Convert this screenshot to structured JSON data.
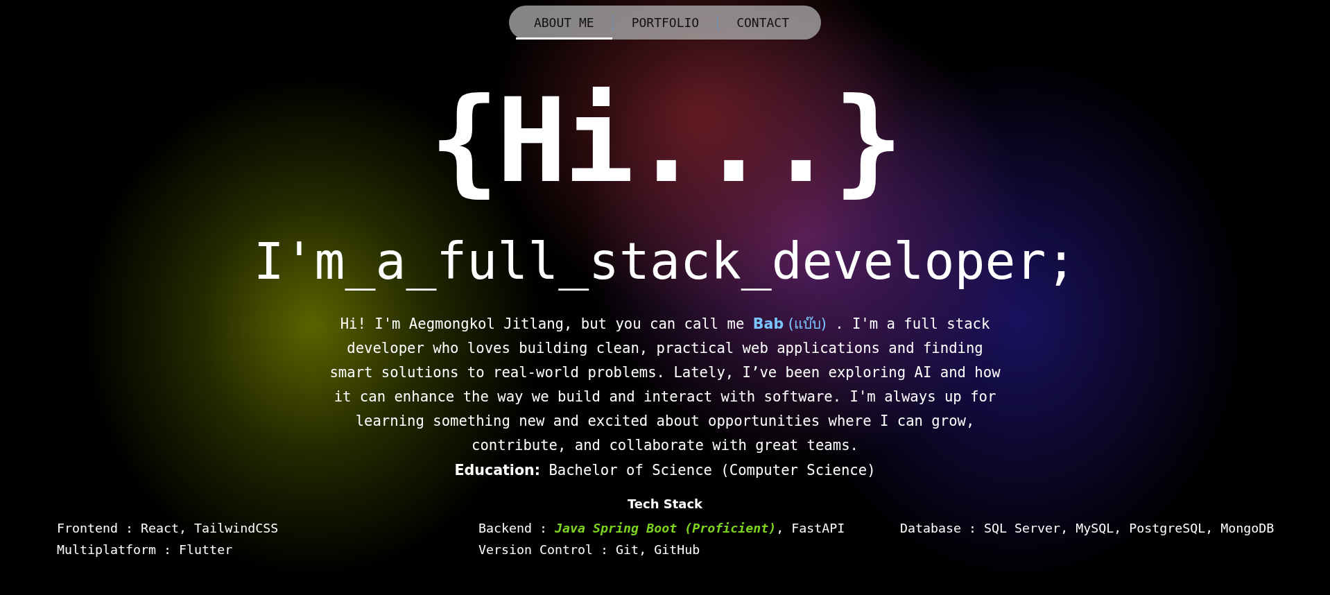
{
  "nav": {
    "tabs": [
      {
        "label": "ABOUT ME",
        "selected": true
      },
      {
        "label": "PORTFOLIO",
        "selected": false
      },
      {
        "label": "CONTACT",
        "selected": false
      }
    ]
  },
  "hero": {
    "greeting": "{Hi...}",
    "subtitle": "I'm_a_full_stack_developer;"
  },
  "intro": {
    "segments": [
      {
        "kind": "plain",
        "text": "Hi! I'm Aegmongkol Jitlang, but you can call me "
      },
      {
        "kind": "name",
        "text": "Bab"
      },
      {
        "kind": "nickname",
        "text": " (แบ๊บ)"
      },
      {
        "kind": "plain",
        "text": " . I'm a full stack developer who loves building clean, practical web applications and finding smart solutions to real-world problems. Lately, I’ve been exploring AI and how it can enhance the way we build and interact with software. I'm always up for learning something new and excited about opportunities where I can grow, contribute, and collaborate with great teams."
      }
    ]
  },
  "education": {
    "label": "Education:",
    "value": "Bachelor of Science (Computer Science)"
  },
  "tech_stack": {
    "title": "Tech Stack",
    "items": [
      {
        "text": "Frontend : React, TailwindCSS"
      },
      {
        "text": "Backend : *Java Spring Boot (Proficient)*, FastAPI"
      },
      {
        "text": "Database : SQL Server, MySQL, PostgreSQL, MongoDB"
      },
      {
        "text": "Multiplatform : Flutter"
      },
      {
        "text": "Version Control : Git, GitHub"
      }
    ]
  }
}
